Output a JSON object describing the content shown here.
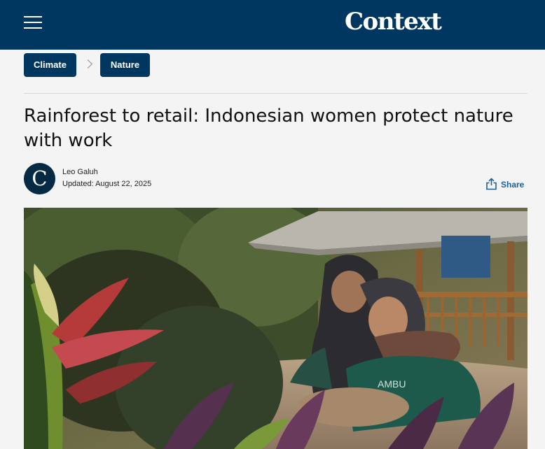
{
  "header": {
    "brand": "Context",
    "menu_icon": "hamburger-menu-icon",
    "background_color": "#003761"
  },
  "breadcrumb": {
    "items": [
      {
        "label": "Climate"
      },
      {
        "label": "Nature"
      }
    ],
    "separator_icon": "chevron-right-icon"
  },
  "article": {
    "title": "Rainforest to retail: Indonesian women protect nature with work",
    "author": "Leo Galuh",
    "updated": "Updated: August 22, 2025",
    "avatar_initial": "C",
    "share_label": "Share",
    "share_icon": "share-icon",
    "hero_shirt_text": "AMBU"
  },
  "colors": {
    "accent": "#003761",
    "share_link": "#1f5f93"
  }
}
